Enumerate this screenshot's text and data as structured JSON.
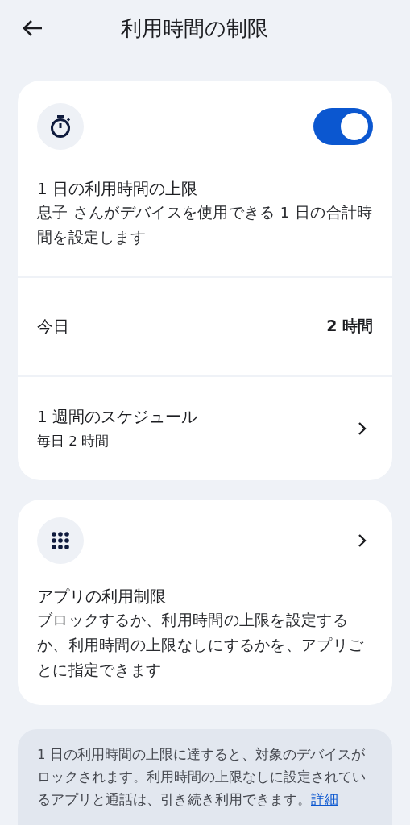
{
  "header": {
    "title": "利用時間の制限"
  },
  "daily_limit": {
    "on": true,
    "title": "1 日の利用時間の上限",
    "description": "息子 さんがデバイスを使用できる 1 日の合計時間を設定します",
    "today": {
      "label": "今日",
      "value": "2 時間"
    },
    "schedule": {
      "title": "1 週間のスケジュール",
      "subtitle": "毎日 2 時間"
    }
  },
  "app_limits": {
    "title": "アプリの利用制限",
    "description": "ブロックするか、利用時間の上限を設定するか、利用時間の上限なしにするかを、アプリごとに指定できます"
  },
  "info": {
    "text": "1 日の利用時間の上限に達すると、対象のデバイスがロックされます。利用時間の上限なしに設定されているアプリと通話は、引き続き利用できます。",
    "link": "詳細"
  }
}
